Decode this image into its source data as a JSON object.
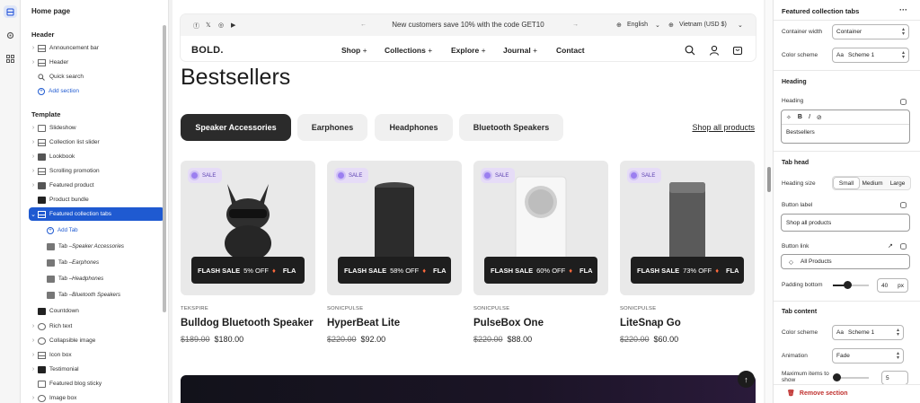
{
  "rail": {
    "icons": [
      "sections-icon",
      "settings-gear-icon",
      "apps-icon"
    ]
  },
  "sidebar": {
    "title": "Home page",
    "header_group": "Header",
    "header_items": [
      {
        "label": "Announcement bar",
        "icon": "layout-icon"
      },
      {
        "label": "Header",
        "icon": "layout-icon"
      },
      {
        "label": "Quick search",
        "icon": "search-icon"
      }
    ],
    "add_section": "Add section",
    "template_group": "Template",
    "template_items": [
      {
        "label": "Slideshow",
        "icon": "slideshow-icon"
      },
      {
        "label": "Collection list slider",
        "icon": "grid-icon"
      },
      {
        "label": "Lookbook",
        "icon": "image-icon"
      },
      {
        "label": "Scrolling promotion",
        "icon": "grid-icon"
      },
      {
        "label": "Featured product",
        "icon": "image-icon"
      },
      {
        "label": "Product bundle",
        "icon": "product-icon"
      },
      {
        "label": "Featured collection tabs",
        "icon": "grid-icon"
      }
    ],
    "add_tab": "Add Tab",
    "tabs": [
      {
        "prefix": "Tab – ",
        "name": "Speaker Accessories"
      },
      {
        "prefix": "Tab – ",
        "name": "Earphones"
      },
      {
        "prefix": "Tab – ",
        "name": "Headphones"
      },
      {
        "prefix": "Tab – ",
        "name": "Bluetooth Speakers"
      }
    ],
    "after_items": [
      {
        "label": "Countdown",
        "icon": "product-icon"
      },
      {
        "label": "Rich text",
        "icon": "text-icon"
      },
      {
        "label": "Collapsible image",
        "icon": "image-icon"
      },
      {
        "label": "Icon box",
        "icon": "grid-icon"
      },
      {
        "label": "Testimonial",
        "icon": "dark-icon"
      },
      {
        "label": "Featured blog sticky",
        "icon": "blog-icon"
      },
      {
        "label": "Image box",
        "icon": "image-icon"
      }
    ]
  },
  "preview": {
    "announcement": "New customers save 10% with the code GET10",
    "language": "English",
    "currency": "Vietnam  (USD $)",
    "logo": "BOLD.",
    "menu": [
      {
        "label": "Shop",
        "plus": "+"
      },
      {
        "label": "Collections",
        "plus": "+"
      },
      {
        "label": "Explore",
        "plus": "+"
      },
      {
        "label": "Journal",
        "plus": "+"
      },
      {
        "label": "Contact",
        "plus": ""
      }
    ],
    "heading": "Bestsellers",
    "tabs": [
      "Speaker Accessories",
      "Earphones",
      "Headphones",
      "Bluetooth Speakers"
    ],
    "shop_all": "Shop all products",
    "products": [
      {
        "vendor": "TEKSPIRE",
        "name": "Bulldog Bluetooth Speaker",
        "compare": "$189.00",
        "price": "$180.00",
        "badge": "SALE",
        "flash": "FLASH SALE",
        "off": "5% OFF"
      },
      {
        "vendor": "SONICPULSE",
        "name": "HyperBeat Lite",
        "compare": "$220.00",
        "price": "$92.00",
        "badge": "SALE",
        "flash": "FLASH SALE",
        "off": "58% OFF"
      },
      {
        "vendor": "SONICPULSE",
        "name": "PulseBox One",
        "compare": "$220.00",
        "price": "$88.00",
        "badge": "SALE",
        "flash": "FLASH SALE",
        "off": "60% OFF"
      },
      {
        "vendor": "SONICPULSE",
        "name": "LiteSnap Go",
        "compare": "$220.00",
        "price": "$60.00",
        "badge": "SALE",
        "flash": "FLASH SALE",
        "off": "73% OFF"
      }
    ],
    "flash_trail": "FLA"
  },
  "panel": {
    "title": "Featured collection tabs",
    "container_width_label": "Container width",
    "container_width_value": "Container",
    "color_scheme_label": "Color scheme",
    "color_scheme_value": "Scheme 1",
    "heading_section": "Heading",
    "heading_label": "Heading",
    "heading_value": "Bestsellers",
    "tab_head_section": "Tab head",
    "heading_size_label": "Heading size",
    "heading_size_options": [
      "Small",
      "Medium",
      "Large"
    ],
    "heading_size_selected": "Small",
    "button_label_label": "Button label",
    "button_label_value": "Shop all products",
    "button_link_label": "Button link",
    "button_link_value": "All Products",
    "padding_bottom_label": "Padding bottom",
    "padding_bottom_value": "40",
    "padding_bottom_unit": "px",
    "padding_bottom_fraction": 0.4,
    "tab_content_section": "Tab content",
    "tc_color_scheme_label": "Color scheme",
    "tc_color_scheme_value": "Scheme 1",
    "animation_label": "Animation",
    "animation_value": "Fade",
    "max_items_label": "Maximum items to show",
    "max_items_value": "5",
    "remove_label": "Remove section"
  },
  "colors": {
    "accent": "#1f5ad1",
    "danger": "#c0312f",
    "dark": "#2b2b2b"
  }
}
